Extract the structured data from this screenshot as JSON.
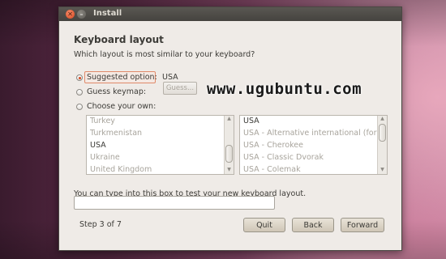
{
  "window": {
    "title": "Install"
  },
  "page": {
    "heading": "Keyboard layout",
    "question": "Which layout is most similar to your keyboard?",
    "options": {
      "suggested_label": "Suggested option:",
      "suggested_value": "USA",
      "guess_label": "Guess keymap:",
      "guess_button": "Guess...",
      "choose_label": "Choose your own:"
    },
    "country_list": [
      "Turkey",
      "Turkmenistan",
      "USA",
      "Ukraine",
      "United Kingdom"
    ],
    "country_selected": "USA",
    "variant_list": [
      "USA",
      "USA - Alternative international (former us_intl)",
      "USA - Cherokee",
      "USA - Classic Dvorak",
      "USA - Colemak"
    ],
    "variant_selected": "USA",
    "test_label": "You can type into this box to test your new keyboard layout.",
    "test_value": "",
    "step": "Step 3 of 7"
  },
  "buttons": {
    "quit": "Quit",
    "back": "Back",
    "forward": "Forward"
  },
  "watermark": "www.ugubuntu.com",
  "colors": {
    "accent": "#d8461d",
    "window_bg": "#efebe7",
    "titlebar": "#4f4c48"
  }
}
